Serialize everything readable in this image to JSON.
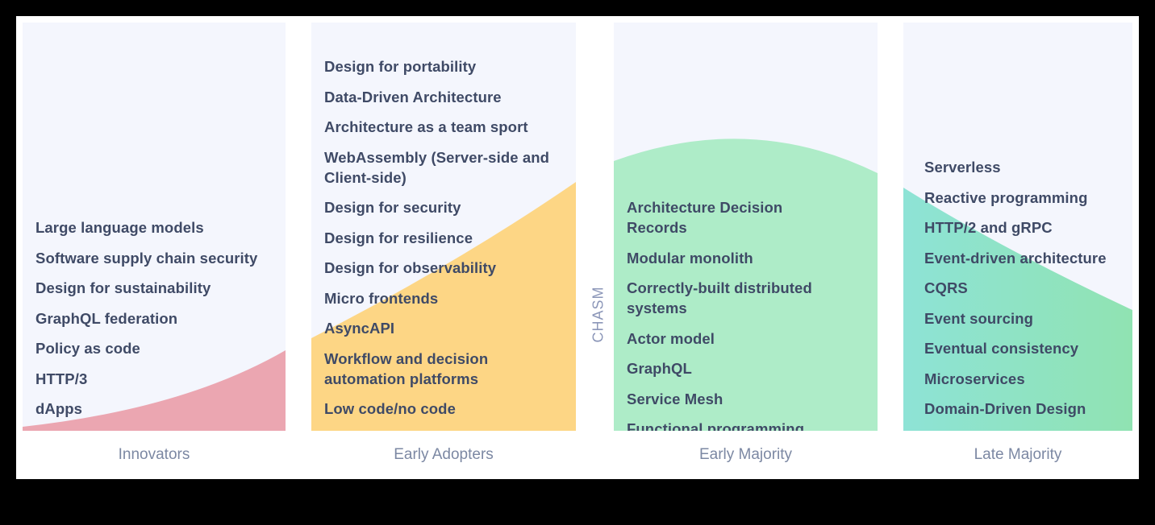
{
  "colors": {
    "panel_bg": "#f4f6fd",
    "innovators": "#eba6b1",
    "early_adopters": "#fdd685",
    "early_majority": "#aeecc8",
    "late_majority_start": "#8ee3d6",
    "late_majority_end": "#90e3b2",
    "text": "#3f4a66",
    "stage_label": "#7c88a3"
  },
  "chasm_label": "CHASM",
  "stages": [
    {
      "label": "Innovators",
      "items": [
        "Large language models",
        "Software supply chain security",
        "Design for sustainability",
        "GraphQL federation",
        "Policy as code",
        "HTTP/3",
        "dApps"
      ]
    },
    {
      "label": "Early Adopters",
      "items": [
        "Design for portability",
        "Data-Driven Architecture",
        "Architecture as a team sport",
        "WebAssembly (Server-side and Client-side)",
        "Design for security",
        "Design for resilience",
        "Design for observability",
        "Micro frontends",
        "AsyncAPI",
        "Workflow and decision automation platforms",
        "Low code/no code"
      ]
    },
    {
      "label": "Early Majority",
      "items": [
        "Architecture Decision Records",
        "Modular monolith",
        "Correctly-built distributed systems",
        "Actor model",
        "GraphQL",
        "Service Mesh",
        "Functional programming"
      ]
    },
    {
      "label": "Late Majority",
      "items": [
        "Serverless",
        "Reactive programming",
        "HTTP/2 and gRPC",
        "Event-driven architecture",
        "CQRS",
        "Event sourcing",
        "Eventual consistency",
        "Microservices",
        "Domain-Driven Design"
      ]
    }
  ]
}
